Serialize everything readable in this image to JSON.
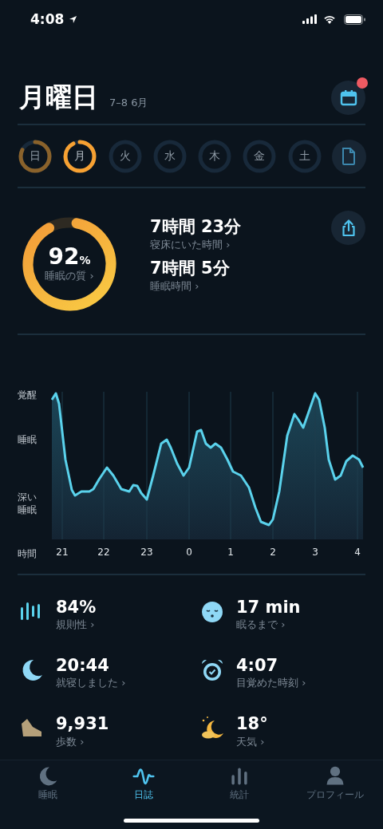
{
  "status_bar": {
    "time": "4:08"
  },
  "header": {
    "title": "月曜日",
    "date": "7–8 6月",
    "calendar_notification": true
  },
  "days": [
    {
      "label": "日",
      "selected": false,
      "recorded": true
    },
    {
      "label": "月",
      "selected": true,
      "recorded": true
    },
    {
      "label": "火",
      "selected": false,
      "recorded": false
    },
    {
      "label": "水",
      "selected": false,
      "recorded": false
    },
    {
      "label": "木",
      "selected": false,
      "recorded": false
    },
    {
      "label": "金",
      "selected": false,
      "recorded": false
    },
    {
      "label": "土",
      "selected": false,
      "recorded": false
    }
  ],
  "quality": {
    "value": "92",
    "unit": "%",
    "label": "睡眠の質 ›"
  },
  "durations": [
    {
      "value": "7時間 23分",
      "label": "寝床にいた時間 ›"
    },
    {
      "value": "7時間 5分",
      "label": "睡眠時間 ›"
    }
  ],
  "hypnogram": {
    "y_labels": [
      "覚醒",
      "睡眠",
      "深い睡眠"
    ],
    "x_title": "時間",
    "x_labels": [
      "21",
      "22",
      "23",
      "0",
      "1",
      "2",
      "3",
      "4"
    ]
  },
  "stats": [
    {
      "kind": "bars",
      "value": "84%",
      "label": "規則性 ›"
    },
    {
      "kind": "face",
      "value": "17 min",
      "label": "眠るまで ›"
    },
    {
      "kind": "moon",
      "value": "20:44",
      "label": "就寝しました ›"
    },
    {
      "kind": "alarm",
      "value": "4:07",
      "label": "目覚めた時刻 ›"
    },
    {
      "kind": "shoe",
      "value": "9,931",
      "label": "歩数 ›"
    },
    {
      "kind": "weather",
      "value": "18°",
      "label": "天気 ›"
    }
  ],
  "tabs": [
    {
      "kind": "moon",
      "label": "睡眠",
      "selected": false
    },
    {
      "kind": "wave",
      "label": "日誌",
      "selected": true
    },
    {
      "kind": "chart",
      "label": "統計",
      "selected": false
    },
    {
      "kind": "person",
      "label": "プロフィール",
      "selected": false
    }
  ]
}
